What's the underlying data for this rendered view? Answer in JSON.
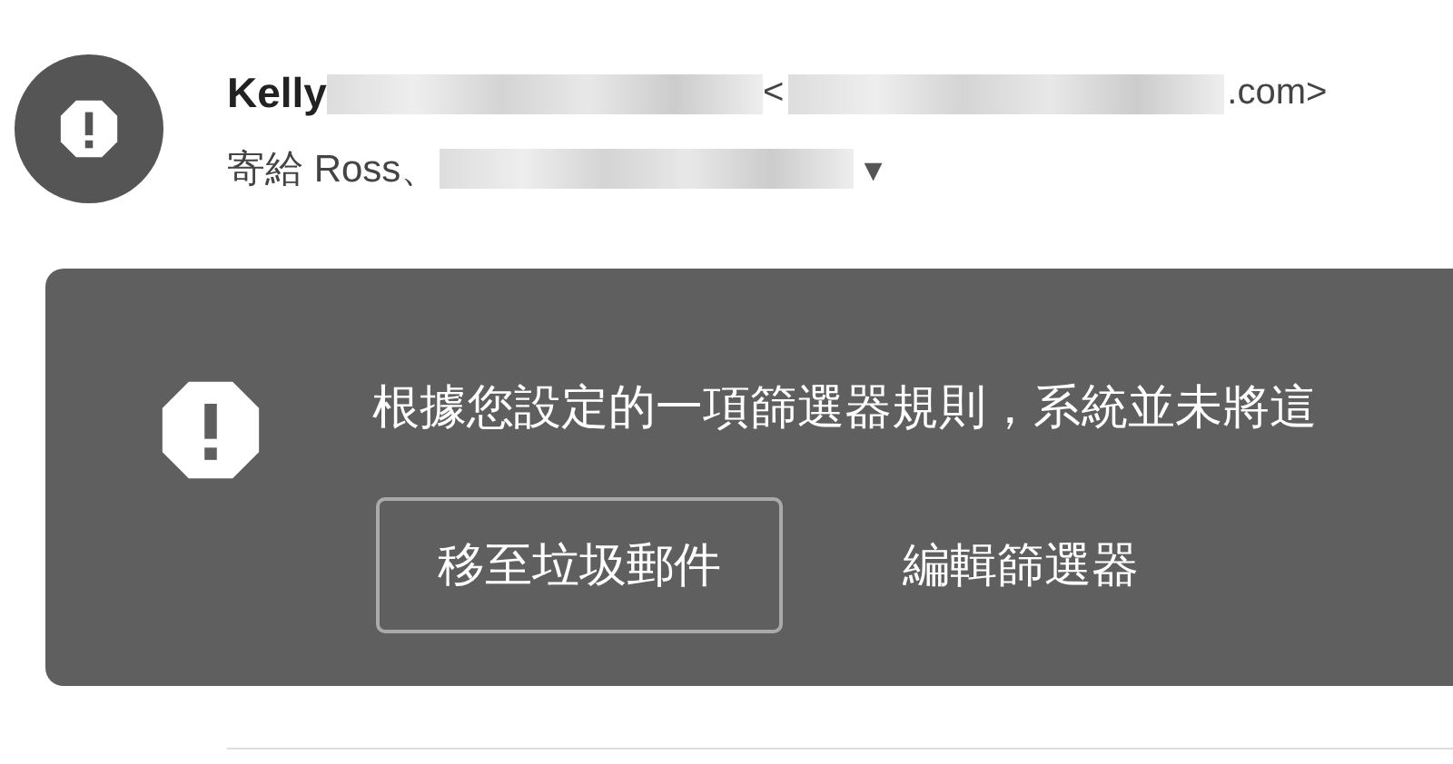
{
  "sender": {
    "name": "Kelly",
    "address_open": "<",
    "address_end": ".com>"
  },
  "recipients": {
    "prefix": "寄給 Ross、",
    "caret": "▾"
  },
  "banner": {
    "message": "根據您設定的一項篩選器規則，系統並未將這",
    "buttons": [
      {
        "label": "移至垃圾郵件",
        "kind": "outlined"
      },
      {
        "label": "編輯篩選器",
        "kind": "text"
      }
    ]
  }
}
